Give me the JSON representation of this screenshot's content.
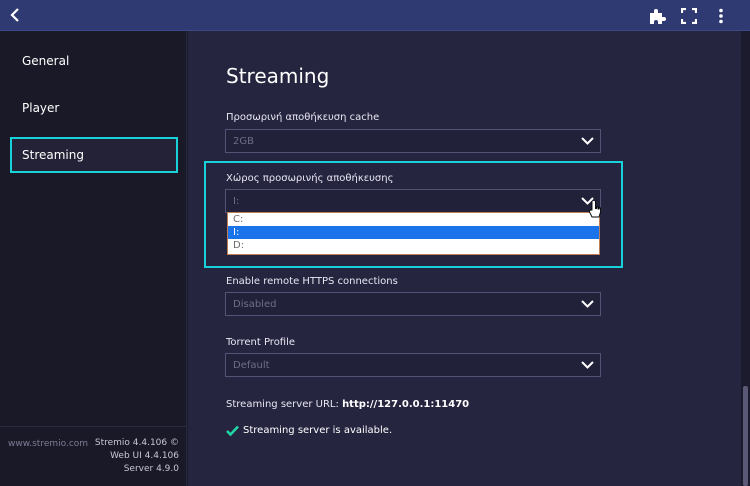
{
  "sidebar": {
    "items": [
      {
        "label": "General"
      },
      {
        "label": "Player"
      },
      {
        "label": "Streaming"
      }
    ],
    "footer": {
      "site": "www.stremio.com",
      "versions": [
        "Stremio 4.4.106 ©",
        "Web UI 4.4.106",
        "Server 4.9.0"
      ]
    }
  },
  "main": {
    "title": "Streaming",
    "cache": {
      "label": "Προσωρινή αποθήκευση cache",
      "value": "2GB"
    },
    "cache_location": {
      "label": "Χώρος προσωρινής αποθήκευσης",
      "value": "I:",
      "options": [
        "C:",
        "I:",
        "D:"
      ],
      "selected": "I:"
    },
    "https": {
      "label": "Enable remote HTTPS connections",
      "value": "Disabled"
    },
    "torrent": {
      "label": "Torrent Profile",
      "value": "Default"
    },
    "server_url_label": "Streaming server URL:",
    "server_url": "http://127.0.0.1:11470",
    "server_status": "Streaming server is available."
  },
  "colors": {
    "accent": "#19d1d9",
    "selected_option": "#1a73e8",
    "topbar": "#2f3a73"
  },
  "icons": {
    "back": "chevron-left-icon",
    "addons": "puzzle-icon",
    "fullscreen": "fullscreen-icon",
    "menu": "more-vertical-icon",
    "status": "checkmark-icon"
  }
}
